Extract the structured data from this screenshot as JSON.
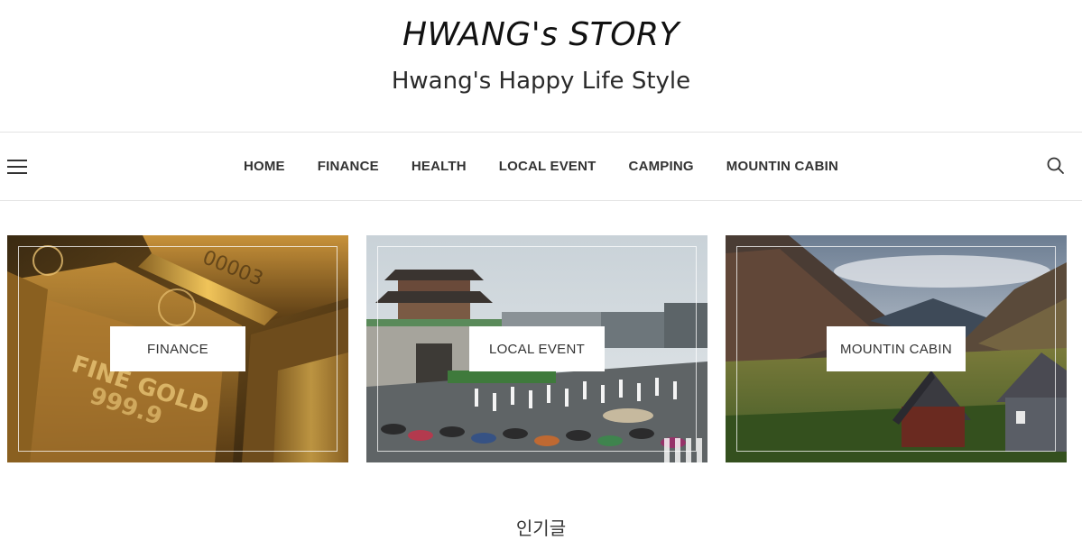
{
  "header": {
    "title": "HWANG's STORY",
    "tagline": "Hwang's Happy Life Style"
  },
  "nav": {
    "items": [
      "HOME",
      "FINANCE",
      "HEALTH",
      "LOCAL EVENT",
      "CAMPING",
      "MOUNTIN CABIN"
    ]
  },
  "icons": {
    "menu": "hamburger-menu-icon",
    "search": "search-icon"
  },
  "cards": [
    {
      "label": "FINANCE",
      "image": "gold bars"
    },
    {
      "label": "LOCAL EVENT",
      "image": "street parade in rain"
    },
    {
      "label": "MOUNTIN CABIN",
      "image": "mountain valley with cabins"
    }
  ],
  "section": {
    "heading": "인기글"
  },
  "colors": {
    "text": "#333333",
    "border": "#e3e3e3",
    "background": "#ffffff"
  }
}
